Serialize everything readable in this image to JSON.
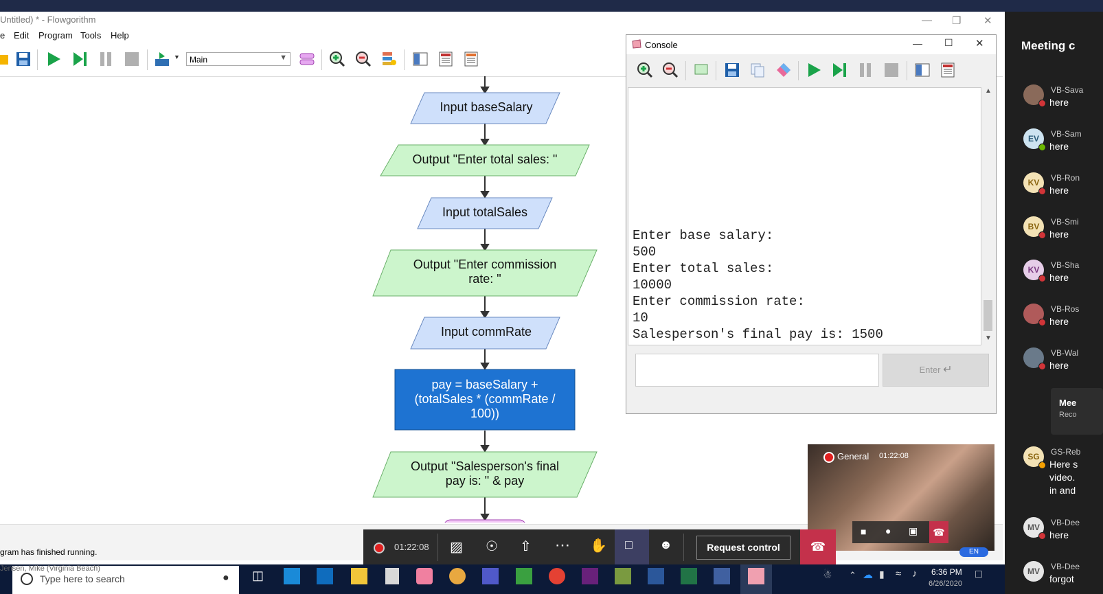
{
  "top_band": {
    "color": "#1f2a48"
  },
  "app": {
    "title": "Untitled) * - Flowgorithm",
    "menu": [
      "e",
      "Edit",
      "Program",
      "Tools",
      "Help"
    ],
    "function_select": "Main",
    "status": "gram has finished running."
  },
  "flowchart": {
    "shapes": [
      {
        "type": "input",
        "text": "Input baseSalary"
      },
      {
        "type": "output",
        "text": "Output \"Enter total sales: \""
      },
      {
        "type": "input",
        "text": "Input totalSales"
      },
      {
        "type": "output",
        "text_line1": "Output \"Enter commission",
        "text_line2": "rate: \""
      },
      {
        "type": "input",
        "text": "Input commRate"
      },
      {
        "type": "assign",
        "text_line1": "pay = baseSalary +",
        "text_line2": "(totalSales * (commRate /",
        "text_line3": "100))"
      },
      {
        "type": "output",
        "text_line1": "Output \"Salesperson's final",
        "text_line2": "pay is: \" & pay"
      }
    ],
    "colors": {
      "input": "#cfe0fb",
      "output": "#ccf5cc",
      "assign": "#1e73d2"
    }
  },
  "console": {
    "title": "Console",
    "lines": [
      "Enter base salary:",
      "500",
      "Enter total sales:",
      "10000",
      "Enter commission rate:",
      "10",
      "Salesperson's final pay is: 1500"
    ],
    "enter_label": "Enter"
  },
  "teams": {
    "header": "Meeting c",
    "participants": [
      {
        "initials": "",
        "name": "VB-Sava",
        "msg": "here",
        "status": "#d13438"
      },
      {
        "initials": "EV",
        "name": "VB-Sam",
        "msg": "here",
        "status": "#6bb700"
      },
      {
        "initials": "KV",
        "name": "VB-Ron",
        "msg": "here",
        "status": "#d13438"
      },
      {
        "initials": "BV",
        "name": "VB-Smi",
        "msg": "here",
        "status": "#d13438"
      },
      {
        "initials": "KV",
        "name": "VB-Sha",
        "msg": "here",
        "status": "#d13438"
      },
      {
        "initials": "",
        "name": "VB-Ros",
        "msg": "here",
        "status": "#d13438"
      },
      {
        "initials": "",
        "name": "VB-Wal",
        "msg": "here",
        "status": "#d13438"
      }
    ],
    "meeting_card": {
      "title": "Mee",
      "sub": "Reco"
    },
    "gs_message": {
      "initials": "SG",
      "name": "GS-Reb",
      "line1": "Here s",
      "line2": "video.",
      "line3": "in and"
    },
    "last_participants": [
      {
        "initials": "MV",
        "name": "VB-Dee",
        "msg": "here"
      },
      {
        "initials": "MV",
        "name": "VB-Dee",
        "msg": "forgot"
      }
    ]
  },
  "video": {
    "channel": "General",
    "time": "01:22:08"
  },
  "call_bar": {
    "time": "01:22:08",
    "request_control": "Request control"
  },
  "taskbar": {
    "overlay_caption": "Jensen, Mike (Virginia Beach)",
    "search_placeholder": "Type here to search",
    "clock_time": "6:36 PM",
    "clock_date": "6/26/2020",
    "lang": "EN"
  }
}
